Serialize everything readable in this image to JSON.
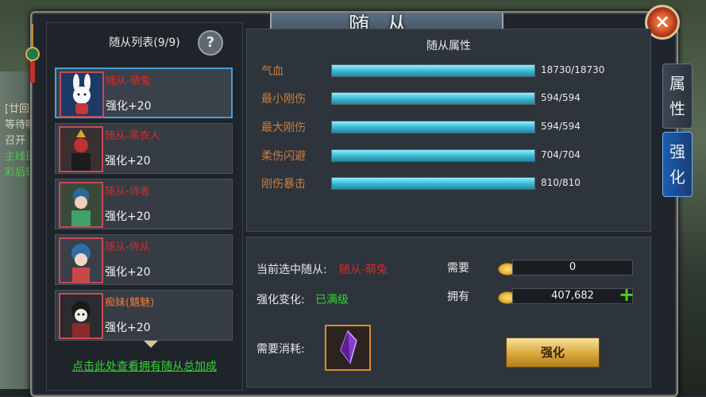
{
  "window": {
    "title": "随从",
    "close_icon": "close-icon"
  },
  "background_left": [
    "[廿回]",
    "等待哪",
    "召开",
    "主线日",
    "彩后轻"
  ],
  "left": {
    "header": "随从列表(9/9)",
    "help_label": "?",
    "items": [
      {
        "name": "随从-萌兔",
        "level": "强化+20",
        "selected": true
      },
      {
        "name": "随从-黑衣人",
        "level": "强化+20",
        "selected": false
      },
      {
        "name": "随从-侍者",
        "level": "强化+20",
        "selected": false
      },
      {
        "name": "随从-侍从",
        "level": "强化+20",
        "selected": false
      },
      {
        "name": "痴妹(魑魅)",
        "level": "强化+20",
        "selected": false
      }
    ],
    "bonus_link": "点击此处查看拥有随从总加成"
  },
  "attributes": {
    "header": "随从属性",
    "rows": [
      {
        "label": "气血",
        "value": "18730/18730",
        "fill": 1.0
      },
      {
        "label": "最小刚伤",
        "value": "594/594",
        "fill": 1.0
      },
      {
        "label": "最大刚伤",
        "value": "594/594",
        "fill": 1.0
      },
      {
        "label": "柔伤闪避",
        "value": "704/704",
        "fill": 1.0
      },
      {
        "label": "刚伤暴击",
        "value": "810/810",
        "fill": 1.0
      }
    ]
  },
  "enhance": {
    "selected_label": "当前选中随从:",
    "selected_name": "随从-萌兔",
    "change_label": "强化变化:",
    "change_value": "已满级",
    "cost_label": "需要消耗:",
    "need_label": "需要",
    "need_value": "0",
    "have_label": "拥有",
    "have_value": "407,682",
    "plus_label": "+",
    "button_label": "强化"
  },
  "tabs": [
    {
      "label": "属性",
      "active": false
    },
    {
      "label": "强化",
      "active": true
    }
  ],
  "colors": {
    "accent": "#4b9cd6",
    "red_text": "#d82a2a",
    "green_text": "#35d336",
    "bar": "#3ab4cf"
  }
}
